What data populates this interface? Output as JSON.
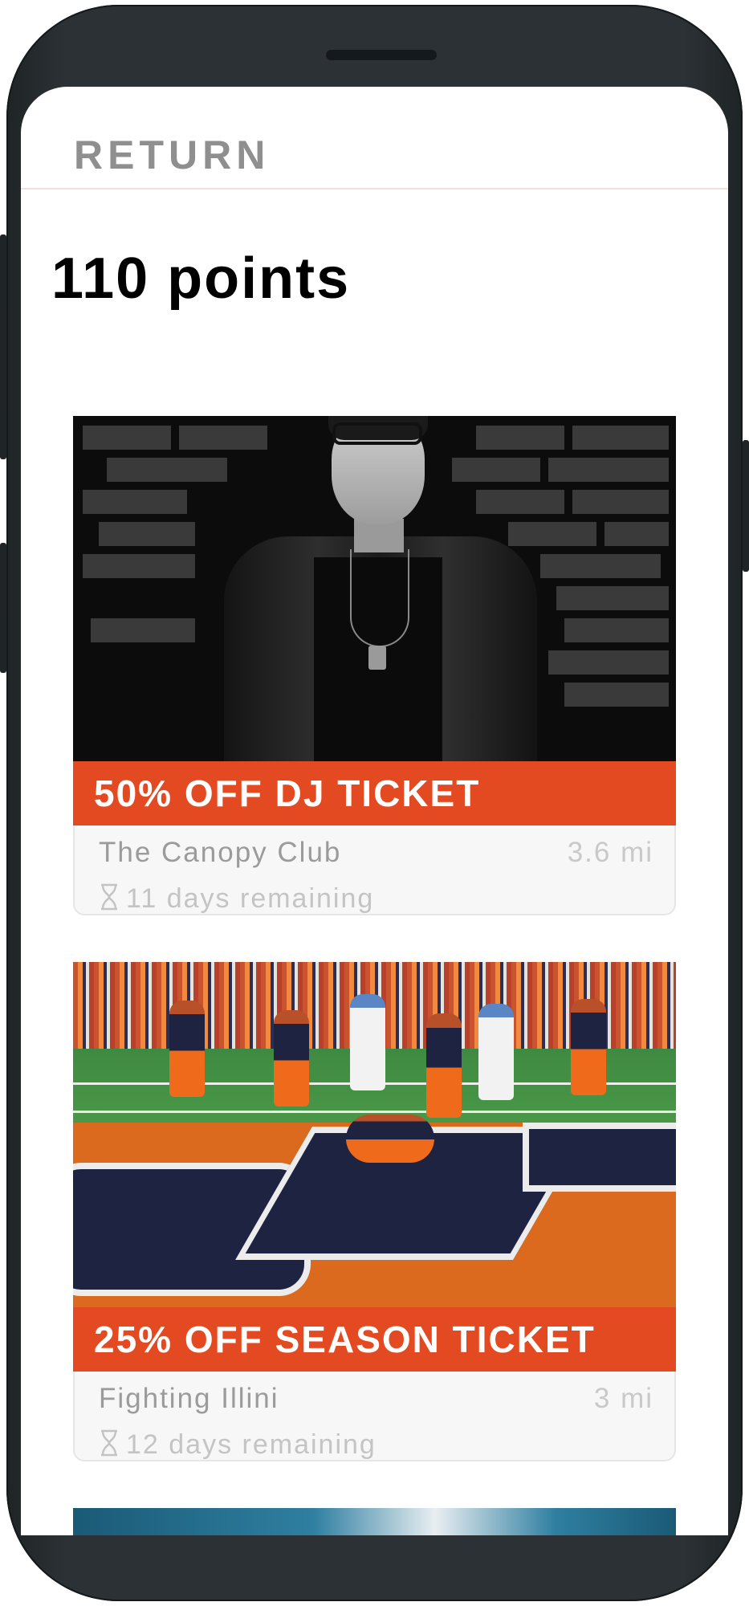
{
  "header": {
    "return_label": "RETURN"
  },
  "points_label": "110 points",
  "offers": [
    {
      "title": "50% OFF DJ TICKET",
      "venue": "The Canopy Club",
      "distance": "3.6 mi",
      "remaining": "11 days remaining"
    },
    {
      "title": "25% OFF SEASON TICKET",
      "venue": "Fighting Illini",
      "distance": "3 mi",
      "remaining": "12 days remaining"
    }
  ],
  "colors": {
    "banner": "#e34a22",
    "text_muted": "#9b9b9b"
  }
}
